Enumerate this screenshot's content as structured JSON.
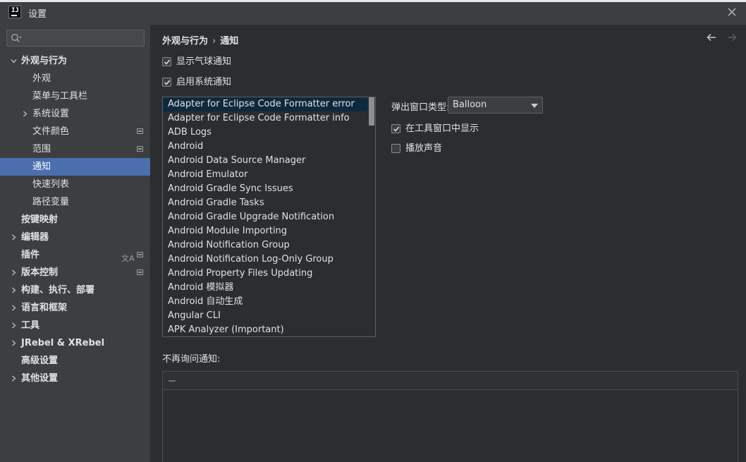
{
  "window": {
    "title": "设置"
  },
  "app_logo": {
    "text": "IJ"
  },
  "sidebar": {
    "search_placeholder": "",
    "items": [
      {
        "label": "外观与行为",
        "expanded": true,
        "bold": true
      },
      {
        "label": "外观"
      },
      {
        "label": "菜单与工具栏"
      },
      {
        "label": "系统设置",
        "collapsed": true
      },
      {
        "label": "文件颜色",
        "badge": true
      },
      {
        "label": "范围",
        "badge": true
      },
      {
        "label": "通知",
        "selected": true
      },
      {
        "label": "快速列表"
      },
      {
        "label": "路径变量"
      },
      {
        "label": "按键映射",
        "bold": true
      },
      {
        "label": "编辑器",
        "collapsed": true,
        "bold": true
      },
      {
        "label": "插件",
        "bold": true,
        "badge": true,
        "translate_icon": true
      },
      {
        "label": "版本控制",
        "collapsed": true,
        "bold": true,
        "badge": true
      },
      {
        "label": "构建、执行、部署",
        "collapsed": true,
        "bold": true
      },
      {
        "label": "语言和框架",
        "collapsed": true,
        "bold": true
      },
      {
        "label": "工具",
        "collapsed": true,
        "bold": true
      },
      {
        "label": "JRebel & XRebel",
        "collapsed": true,
        "bold": true
      },
      {
        "label": "高级设置",
        "bold": true
      },
      {
        "label": "其他设置",
        "collapsed": true,
        "bold": true
      }
    ]
  },
  "main": {
    "breadcrumb": [
      "外观与行为",
      "通知"
    ],
    "breadcrumb_sep": "›",
    "options": {
      "show_balloons": {
        "label": "显示气球通知",
        "checked": true
      },
      "system_notifications": {
        "label": "启用系统通知",
        "checked": true
      }
    },
    "notification_groups": [
      "Adapter for Eclipse Code Formatter error",
      "Adapter for Eclipse Code Formatter info",
      "ADB Logs",
      "Android",
      "Android Data Source Manager",
      "Android Emulator",
      "Android Gradle Sync Issues",
      "Android Gradle Tasks",
      "Android Gradle Upgrade Notification",
      "Android Module Importing",
      "Android Notification Group",
      "Android Notification Log-Only Group",
      "Android Property Files Updating",
      "Android 模拟器",
      "Android 自动生成",
      "Angular CLI",
      "APK Analyzer (Important)"
    ],
    "selected_group_index": 0,
    "popup_type": {
      "label": "弹出窗口类型:",
      "value": "Balloon"
    },
    "show_in_tool_window": {
      "label": "在工具窗口中显示",
      "checked": true
    },
    "play_sound": {
      "label": "播放声音",
      "checked": false
    },
    "no_ask_label": "不再询问通知:"
  },
  "colors": {
    "selection": "#4b6eaf",
    "list_selection": "#0d293e",
    "sidebar_bg": "#3c3f41",
    "main_bg": "#2b2d30"
  }
}
